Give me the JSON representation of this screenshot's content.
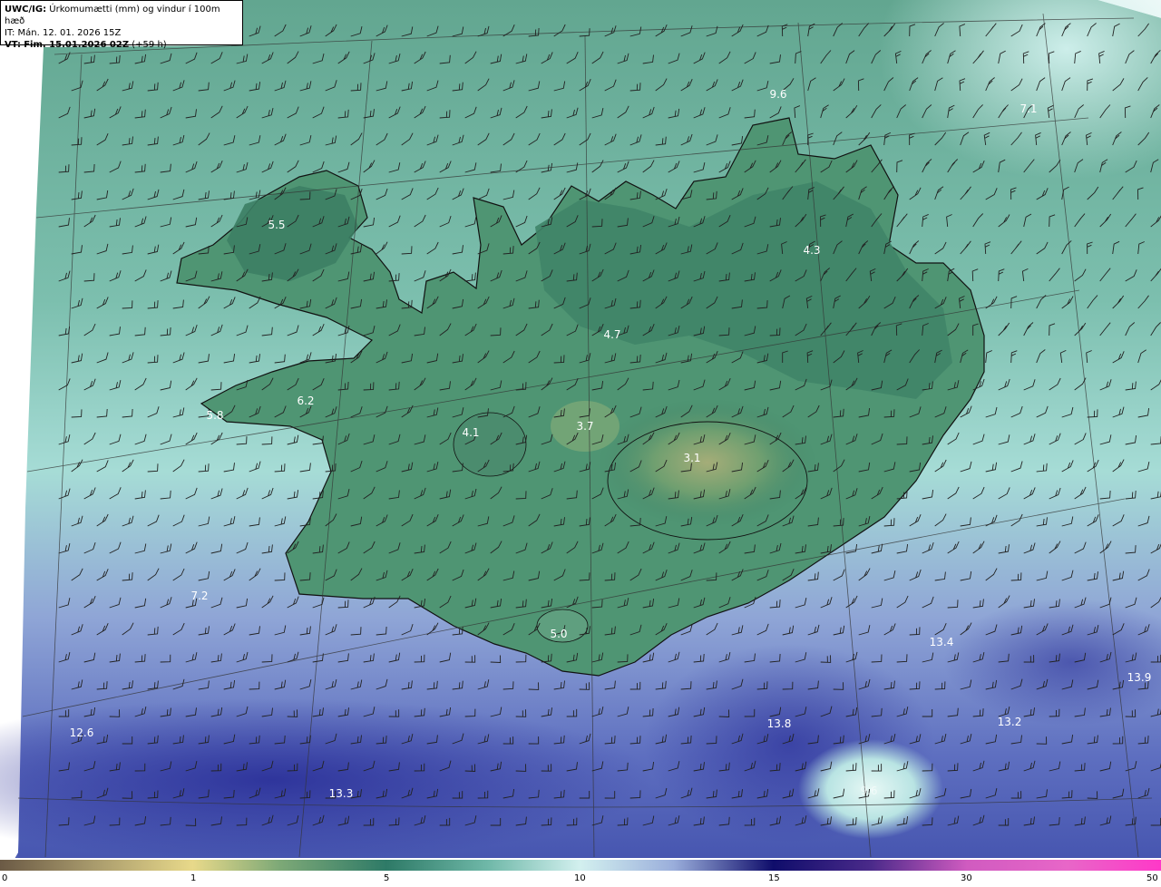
{
  "header": {
    "product": "UWC/IG:",
    "title": "Úrkomumætti (mm) og vindur í 100m hæð",
    "init_time": "IT: Mán. 12. 01. 2026 15Z",
    "valid_prefix": "VT:",
    "valid_time": "Fim. 15.01.2026 02Z",
    "lead_time": "(+59 h)"
  },
  "colorbar": {
    "ticks": [
      "0",
      "1",
      "5",
      "10",
      "15",
      "30",
      "50"
    ],
    "colors": [
      "#6b5a45",
      "#b7a77a",
      "#e8d98a",
      "#5a9e6e",
      "#2e7a67",
      "#8fd2cc",
      "#d3f0ef",
      "#8095d0",
      "#3a3f9e",
      "#0f0d6b",
      "#6a2a90",
      "#d05bc0",
      "#ff38c8"
    ]
  },
  "map_labels": [
    {
      "text": "9.6",
      "tone": "light"
    },
    {
      "text": "7.1",
      "tone": "light"
    },
    {
      "text": "5.5",
      "tone": "light"
    },
    {
      "text": "4.3",
      "tone": "light"
    },
    {
      "text": "4.7",
      "tone": "light"
    },
    {
      "text": "6.2",
      "tone": "light"
    },
    {
      "text": "5.8",
      "tone": "light"
    },
    {
      "text": "4.1",
      "tone": "light"
    },
    {
      "text": "3.7",
      "tone": "light"
    },
    {
      "text": "3.1",
      "tone": "light"
    },
    {
      "text": "7.2",
      "tone": "light"
    },
    {
      "text": "5.0",
      "tone": "light"
    },
    {
      "text": "13.4",
      "tone": "light"
    },
    {
      "text": "13.9",
      "tone": "light"
    },
    {
      "text": "12.6",
      "tone": "light"
    },
    {
      "text": "13.8",
      "tone": "light"
    },
    {
      "text": "13.2",
      "tone": "light"
    },
    {
      "text": "13.3",
      "tone": "light"
    },
    {
      "text": "9.6",
      "tone": "faint"
    }
  ]
}
